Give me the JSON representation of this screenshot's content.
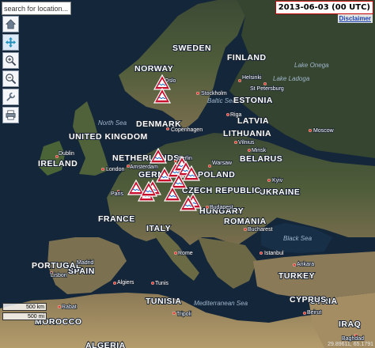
{
  "search": {
    "placeholder": "search for location..."
  },
  "date_label": "2013-06-03 (00 UTC)",
  "disclaimer_label": "Disclaimer",
  "toolbar": {
    "items": [
      {
        "name": "home-icon"
      },
      {
        "name": "pan-icon"
      },
      {
        "name": "zoom-in-icon"
      },
      {
        "name": "zoom-out-icon"
      },
      {
        "name": "wrench-icon"
      },
      {
        "name": "print-icon"
      }
    ]
  },
  "scale": {
    "km_label": "500 km",
    "mi_label": "500 mi"
  },
  "coordinates_readout": "29.89611, 65.1791",
  "colors": {
    "warning_red": "#c8102e",
    "city_dot": "#e03a2e",
    "date_border": "#c40000",
    "link_blue": "#1a3fb0"
  },
  "labels": {
    "countries": [
      "SWEDEN",
      "FINLAND",
      "NORWAY",
      "UNITED KINGDOM",
      "IRELAND",
      "BELARUS",
      "UKRAINE",
      "FRANCE",
      "ITALY",
      "SPAIN",
      "PORTUGAL",
      "ROMANIA",
      "TURKEY",
      "MOROCCO",
      "TUNISIA",
      "SYRIA",
      "IRAQ",
      "ALGERIA",
      "GERM",
      "POLAND",
      "LATVIA",
      "LITHUANIA",
      "CZECH REPUBLIC",
      "HUNGARY",
      "ESTONIA",
      "DENMARK",
      "NETHERLANDS",
      "CYPRUS"
    ],
    "seas": [
      "North Sea",
      "Baltic Sea",
      "Black Sea",
      "Mediterranean Sea",
      "Lake Ladoga",
      "Lake Onega"
    ],
    "cities": [
      "Stockholm",
      "Copenhagen",
      "Oslo",
      "Helsinki",
      "St Petersburg",
      "Riga",
      "Vilnius",
      "Minsk",
      "Moscow",
      "Kyiv",
      "Warsaw",
      "Berlin",
      "Amsterdam",
      "London",
      "Paris",
      "Madrid",
      "Lisbon",
      "Rome",
      "Budapest",
      "Bucharest",
      "Ankara",
      "Algiers",
      "Tunis",
      "Tripoli",
      "Beirut",
      "Baghdad",
      "Rabat",
      "Dublin",
      "Istanbul"
    ]
  },
  "warnings": [
    {
      "kind": "flood"
    },
    {
      "kind": "flood"
    },
    {
      "kind": "flood"
    },
    {
      "kind": "flood"
    },
    {
      "kind": "flood"
    },
    {
      "kind": "flood"
    },
    {
      "kind": "flood"
    },
    {
      "kind": "flood"
    },
    {
      "kind": "flood"
    },
    {
      "kind": "flood"
    },
    {
      "kind": "flood"
    },
    {
      "kind": "flood"
    },
    {
      "kind": "flood"
    },
    {
      "kind": "flood"
    },
    {
      "kind": "flood"
    },
    {
      "kind": "flood"
    }
  ]
}
